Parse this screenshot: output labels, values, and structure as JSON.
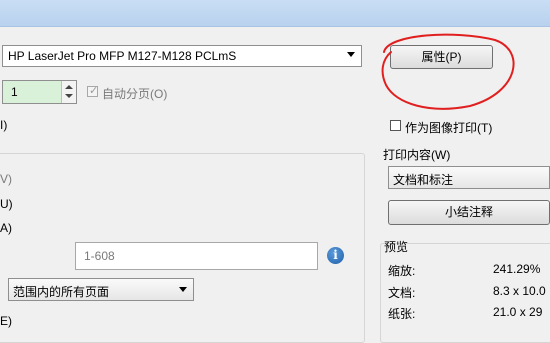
{
  "printer": {
    "selected": "HP LaserJet Pro MFP M127-M128 PCLmS"
  },
  "properties_button": "属性(P)",
  "copies": {
    "value": "1",
    "collate_label": "自动分页(O)"
  },
  "left_edge_labels": [
    "I)",
    "V)",
    "U)",
    "A)",
    "E)"
  ],
  "print_as_image_label": "作为图像打印(T)",
  "print_content": {
    "label": "打印内容(W)",
    "selected": "文档和标注",
    "summarize_button": "小结注释"
  },
  "page_range": {
    "placeholder": "1-608"
  },
  "subset": {
    "selected": "范围内的所有页面"
  },
  "preview": {
    "label": "预览",
    "rows": [
      {
        "label": "缩放:",
        "value": "241.29%"
      },
      {
        "label": "文档:",
        "value": "8.3 x 10.0"
      },
      {
        "label": "纸张:",
        "value": "21.0 x 29"
      }
    ]
  }
}
